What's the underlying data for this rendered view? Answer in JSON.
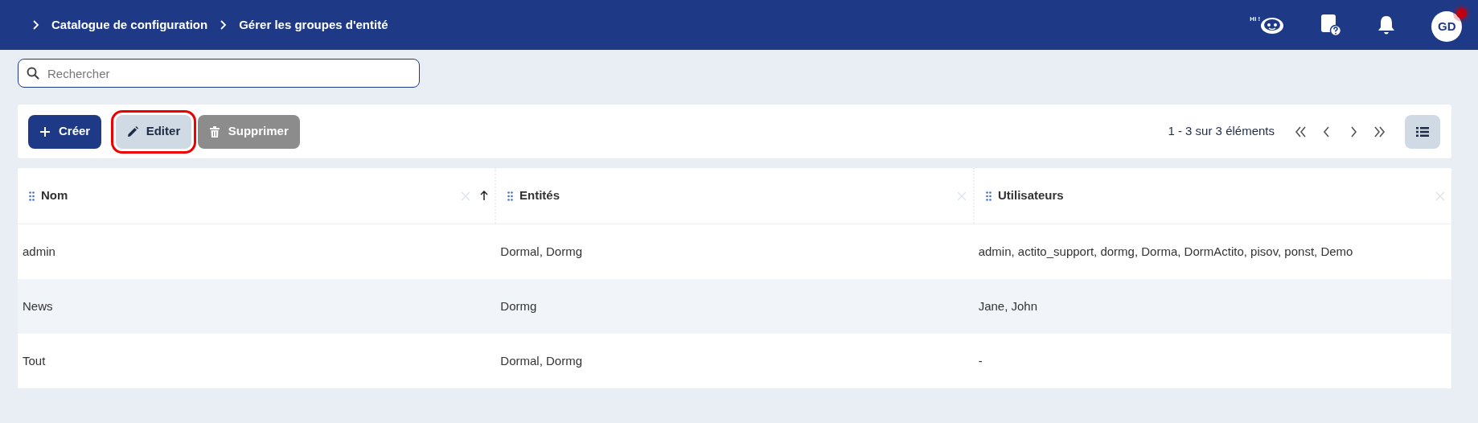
{
  "breadcrumbs": [
    "Catalogue de configuration",
    "Gérer les groupes d'entité"
  ],
  "header": {
    "assistant_badge": "Hi !",
    "avatar": {
      "initials": "GD",
      "notification": true
    }
  },
  "search": {
    "placeholder": "Rechercher"
  },
  "toolbar": {
    "buttons": [
      {
        "label": "Créer",
        "kind": "create",
        "disabled": false,
        "highlighted": false
      },
      {
        "label": "Editer",
        "kind": "edit",
        "disabled": false,
        "highlighted": true
      },
      {
        "label": "Supprimer",
        "kind": "delete",
        "disabled": true,
        "highlighted": false
      }
    ],
    "pagination": "1 - 3 sur 3 éléments"
  },
  "table": {
    "columns": [
      {
        "label": "Nom",
        "sorted": true
      },
      {
        "label": "Entités",
        "sorted": false
      },
      {
        "label": "Utilisateurs",
        "sorted": false
      }
    ],
    "rows": [
      [
        "admin",
        "Dormal, Dormg",
        "admin, actito_support, dormg, Dorma, DormActito, pisov, ponst, Demo"
      ],
      [
        "News",
        "Dormg",
        "Jane, John"
      ],
      [
        "Tout",
        "Dormal, Dormg",
        "-"
      ]
    ]
  }
}
